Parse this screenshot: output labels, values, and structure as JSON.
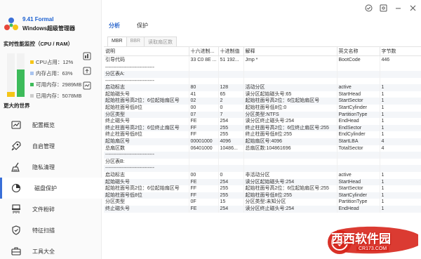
{
  "sidebar": {
    "version": "9.41 Formal",
    "app_name": "Windows超级管理器",
    "monitor_title": "实时性能监控（CPU / RAM）",
    "stats": [
      {
        "label": "CPU占用：12%",
        "swatch": "yellow"
      },
      {
        "label": "内存占用：63%",
        "swatch": "blue"
      },
      {
        "label": "可用内存：2989MB",
        "swatch": "green"
      },
      {
        "label": "已用内存：5078MB",
        "swatch": "gray"
      }
    ],
    "cpu_percent": 12,
    "mem_percent": 63,
    "more_title": "更大的世界",
    "nav": [
      {
        "label": "配置概览",
        "icon": "chart-icon"
      },
      {
        "label": "自启管理",
        "icon": "rocket-icon"
      },
      {
        "label": "隐私清理",
        "icon": "broom-icon"
      },
      {
        "label": "磁盘保护",
        "icon": "disk-pie-icon",
        "active": true
      },
      {
        "label": "文件粉碎",
        "icon": "shredder-icon"
      },
      {
        "label": "特征扫描",
        "icon": "shield-scan-icon"
      },
      {
        "label": "工具大全",
        "icon": "toolbox-icon"
      }
    ]
  },
  "main": {
    "tabs": [
      {
        "label": "分析",
        "active": true
      },
      {
        "label": "保护",
        "active": false
      }
    ],
    "subtabs": [
      {
        "label": "MBR",
        "active": true
      },
      {
        "label": "BBR",
        "active": false
      },
      {
        "label": "读取扇区数",
        "active": false
      }
    ],
    "table": {
      "headers": [
        "说明",
        "十六进制...",
        "十进制值",
        "解释",
        "英文名称",
        "字节数"
      ],
      "rows": [
        [
          "引导代码",
          "33 C0 8E ...",
          "51 192...",
          "Jmp *",
          "BootCode",
          "446"
        ],
        [
          "------------------------------",
          "",
          "",
          "",
          "",
          ""
        ],
        [
          "分区表A:",
          "",
          "",
          "",
          "",
          ""
        ],
        [
          "------------------------------",
          "",
          "",
          "",
          "",
          ""
        ],
        [
          "启动标志",
          "80",
          "128",
          "活动分区",
          "active",
          "1"
        ],
        [
          "起始磁头号",
          "41",
          "65",
          "读分区起始磁头号:65",
          "StartHead",
          "1"
        ],
        [
          "起始柱面号高2位：6位起始扇区号",
          "02",
          "2",
          "起始柱面号高2位：6位起始扇区号",
          "StartSector",
          "1"
        ],
        [
          "起始柱面号低8位",
          "00",
          "0",
          "起始柱面号低8位:0",
          "StartCylinder",
          "1"
        ],
        [
          "分区类型",
          "07",
          "7",
          "分区类型:NTFS",
          "PartitionType",
          "1"
        ],
        [
          "终止磁头号",
          "FE",
          "254",
          "读分区终止磁头号:254",
          "EndHead",
          "1"
        ],
        [
          "终止柱面号高2位：6位终止扇区号",
          "FF",
          "255",
          "终止柱面号高2位：6位终止扇区号:255",
          "EndSector",
          "1"
        ],
        [
          "终止柱面号低8位",
          "FF",
          "255",
          "终止柱面号低8位:255",
          "EndCylinder",
          "1"
        ],
        [
          "起始扇区号",
          "00001000",
          "4096",
          "起始扇区号:4096",
          "StartLBA",
          "4"
        ],
        [
          "总扇区数",
          "06401000",
          "10486...",
          "总扇区数:104861696",
          "TotalSector",
          "4"
        ],
        [
          "------------------------------",
          "",
          "",
          "",
          "",
          ""
        ],
        [
          "分区表B:",
          "",
          "",
          "",
          "",
          ""
        ],
        [
          "------------------------------",
          "",
          "",
          "",
          "",
          ""
        ],
        [
          "启动标志",
          "00",
          "0",
          "非活动分区",
          "active",
          "1"
        ],
        [
          "起始磁头号",
          "FE",
          "254",
          "读分区起始磁头号:254",
          "StartHead",
          "1"
        ],
        [
          "起始柱面号高2位：6位起始扇区号",
          "FF",
          "255",
          "起始柱面号高2位：6位起始扇区号:255",
          "StartSector",
          "1"
        ],
        [
          "起始柱面号低8位",
          "FF",
          "255",
          "起始柱面号低8位:255",
          "StartCylinder",
          "1"
        ],
        [
          "分区类型",
          "0F",
          "15",
          "分区类型:未知分区",
          "PartitionType",
          "1"
        ],
        [
          "终止磁头号",
          "FE",
          "254",
          "读分区终止磁头号:254",
          "EndHead",
          "1"
        ]
      ]
    }
  },
  "watermark": {
    "text": "西西软件园",
    "sub": "CR173.COM"
  },
  "colors": {
    "accent": "#3a6fd8",
    "cpu": "#f5c518",
    "mem": "#3dbb5a",
    "watermark": "#d7261c"
  }
}
